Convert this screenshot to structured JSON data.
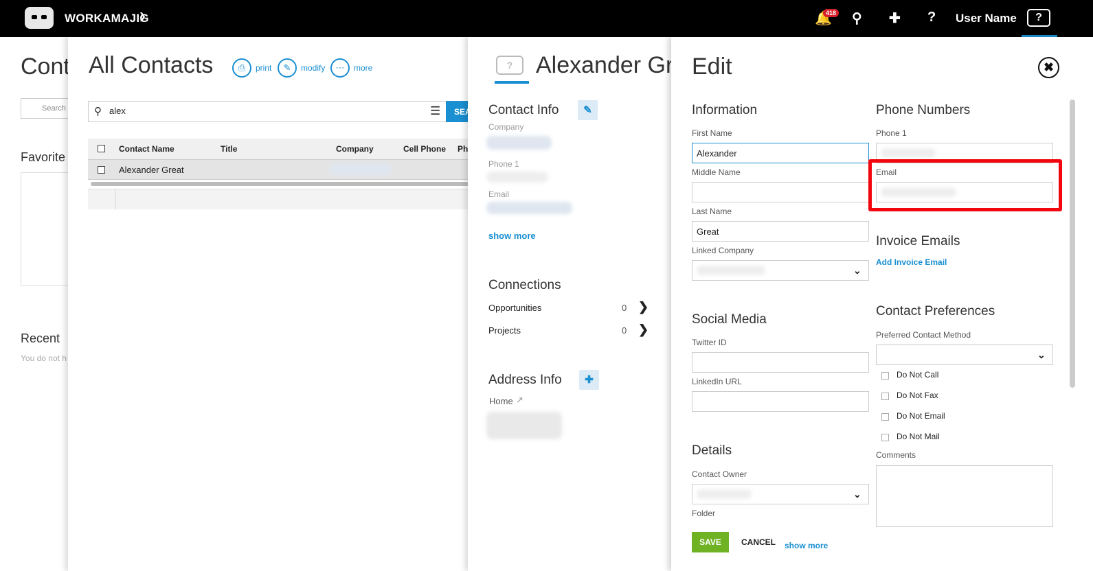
{
  "topbar": {
    "brand": "WORKAMAJIG",
    "notification_count": "418",
    "username": "User Name",
    "help_label": "?"
  },
  "background": {
    "title": "Cont",
    "search_placeholder": "Search I",
    "favorites": "Favorite",
    "recent": "Recent",
    "recent_note": "You do not h"
  },
  "list": {
    "title": "All Contacts",
    "actions": {
      "print": "print",
      "modify": "modify",
      "more": "more"
    },
    "search_value": "alex",
    "search_button": "SEARCH",
    "columns": [
      "Contact Name",
      "Title",
      "Company",
      "Cell Phone",
      "Ph"
    ],
    "rows": [
      {
        "name": "Alexander Great"
      }
    ]
  },
  "detail": {
    "name": "Alexander Great",
    "avatar": "?",
    "contact_info": "Contact Info",
    "company_label": "Company",
    "phone_label": "Phone 1",
    "email_label": "Email",
    "show_more": "show more",
    "connections": "Connections",
    "opportunities": {
      "label": "Opportunities",
      "count": "0"
    },
    "projects": {
      "label": "Projects",
      "count": "0"
    },
    "address_info": "Address Info",
    "home": "Home"
  },
  "edit": {
    "title": "Edit",
    "information": "Information",
    "first_name_label": "First Name",
    "first_name": "Alexander",
    "middle_name_label": "Middle Name",
    "last_name_label": "Last Name",
    "last_name": "Great",
    "linked_company_label": "Linked Company",
    "social_media": "Social Media",
    "twitter_label": "Twitter ID",
    "linkedin_label": "LinkedIn URL",
    "details": "Details",
    "contact_owner_label": "Contact Owner",
    "folder_label": "Folder",
    "phone_numbers": "Phone Numbers",
    "phone1_label": "Phone 1",
    "email_label": "Email",
    "invoice_emails": "Invoice Emails",
    "add_invoice_email": "Add Invoice Email",
    "contact_preferences": "Contact Preferences",
    "preferred_method_label": "Preferred Contact Method",
    "prefs": [
      "Do Not Call",
      "Do Not Fax",
      "Do Not Email",
      "Do Not Mail"
    ],
    "comments_label": "Comments",
    "save": "SAVE",
    "cancel": "CANCEL",
    "show_more": "show more"
  },
  "colors": {
    "accent": "#1a8fd1",
    "save": "#6fb324",
    "highlight": "#f2070f",
    "badge": "#d8202a"
  }
}
